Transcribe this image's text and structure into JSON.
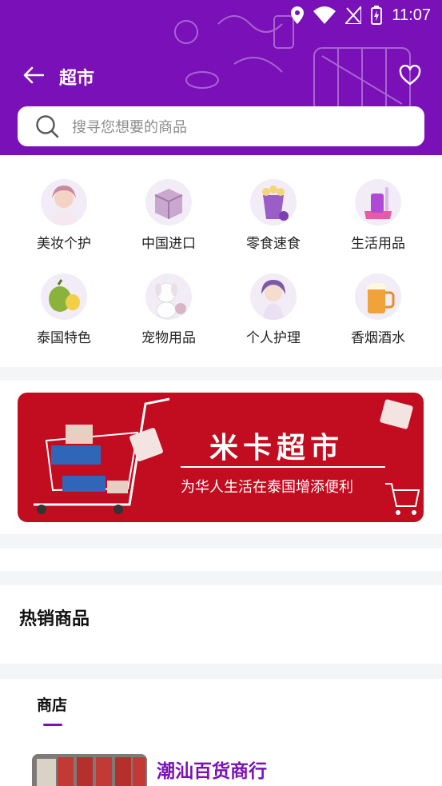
{
  "status_bar": {
    "time": "11:07"
  },
  "header": {
    "title": "超市",
    "back_icon": "arrow-left-icon",
    "favorite_icon": "heart-icon"
  },
  "search": {
    "placeholder": "搜寻您想要的商品"
  },
  "categories": [
    {
      "label": "美妆个护",
      "icon": "beauty-icon"
    },
    {
      "label": "中国进口",
      "icon": "box-icon"
    },
    {
      "label": "零食速食",
      "icon": "snack-icon"
    },
    {
      "label": "生活用品",
      "icon": "toiletries-icon"
    },
    {
      "label": "泰国特色",
      "icon": "durian-icon"
    },
    {
      "label": "宠物用品",
      "icon": "pet-icon"
    },
    {
      "label": "个人护理",
      "icon": "personal-care-icon"
    },
    {
      "label": "香烟酒水",
      "icon": "beer-icon"
    }
  ],
  "banner": {
    "title": "米卡超市",
    "subtitle": "为华人生活在泰国增添便利"
  },
  "hot_products": {
    "title": "热销商品"
  },
  "shops": {
    "tab_label": "商店",
    "items": [
      {
        "name": "潮汕百货商行"
      }
    ]
  },
  "colors": {
    "brand": "#7a10b8",
    "banner_red": "#c20c1f"
  }
}
